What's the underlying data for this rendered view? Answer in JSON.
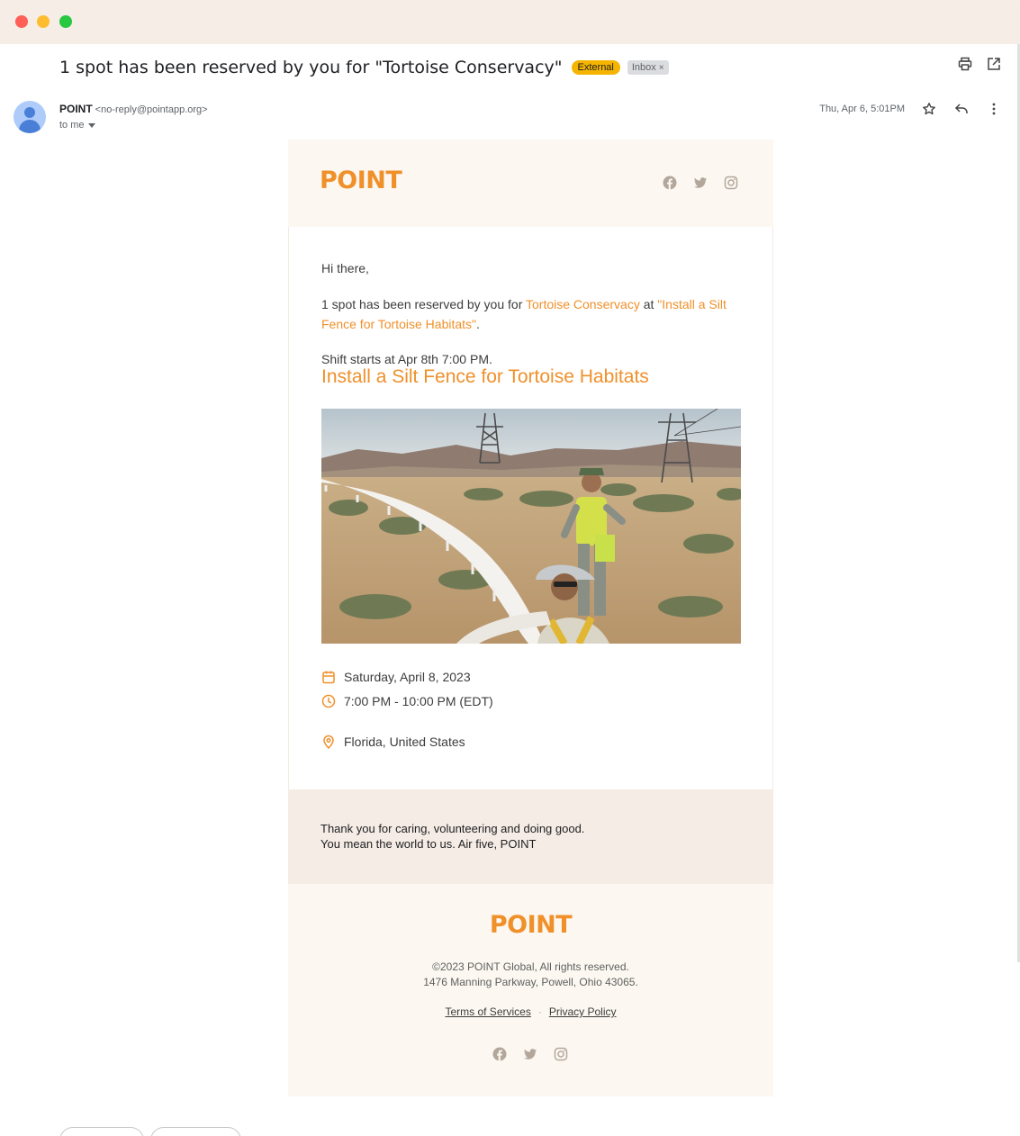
{
  "email": {
    "subject": "1 spot has been reserved by you for \"Tortoise Conservacy\"",
    "labels": {
      "external": "External",
      "inbox": "Inbox",
      "inbox_close": "×"
    },
    "sender": {
      "name": "POINT",
      "email": "<no-reply@pointapp.org>",
      "to": "to me"
    },
    "date": "Thu, Apr 6, 5:01PM",
    "icons": [
      "print-icon",
      "open-in-new-icon",
      "star-icon",
      "reply-icon",
      "more-vert-icon"
    ]
  },
  "body": {
    "brand": "POINT",
    "greeting": "Hi there,",
    "reserve_prefix": "1 spot has been reserved by you for ",
    "org_link": "Tortoise Conservacy",
    "reserve_mid": " at ",
    "event_link": "\"Install a Silt Fence for Tortoise Habitats\"",
    "reserve_end": ".",
    "shift": "Shift starts at Apr 8th 7:00 PM.",
    "event_title": "Install a Silt Fence for Tortoise Habitats",
    "date": "Saturday, April 8, 2023",
    "time": "7:00 PM - 10:00 PM (EDT)",
    "location": "Florida, United States",
    "accent_color": "#f0902a"
  },
  "thanks": {
    "line1": "Thank you for caring, volunteering and doing good.",
    "line2": "You mean the world to us. Air five, POINT"
  },
  "footer": {
    "brand": "POINT",
    "copyright": "©2023 POINT Global, All rights reserved.",
    "address": "1476 Manning Parkway, Powell, Ohio 43065.",
    "terms": "Terms of Services",
    "separator": "·",
    "privacy": "Privacy Policy"
  }
}
